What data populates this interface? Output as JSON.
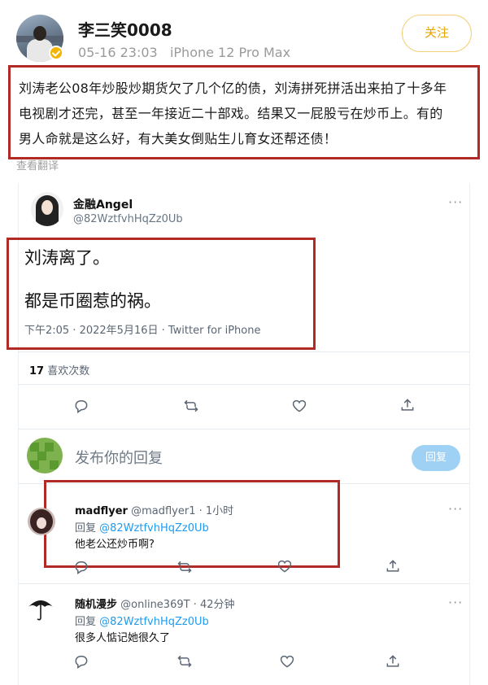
{
  "weibo": {
    "user_name": "李三笑0008",
    "post_time": "05-16 23:03",
    "device": "iPhone 12 Pro Max",
    "follow_label": "关注",
    "post_lines": [
      "刘涛老公08年炒股炒期货欠了几个亿的债，刘涛拼死拼活出来拍了十多年",
      "电视剧才还完，甚至一年接近二十部戏。结果又一屁股亏在炒币上。有的",
      "男人命就是这么好，有大美女倒贴生儿育女还帮还债！"
    ],
    "translate_label": "查看翻译"
  },
  "tweet": {
    "author_name": "金融Angel",
    "author_handle": "@82WztfvhHqZz0Ub",
    "line1": "刘涛离了。",
    "line2": "都是币圈惹的祸。",
    "timestamp": "下午2:05 · 2022年5月16日 · Twitter for iPhone",
    "likes_count": "17",
    "likes_label": "喜欢次数",
    "more_icon": "more-horizontal-icon"
  },
  "reply_box": {
    "placeholder": "发布你的回复",
    "button_label": "回复"
  },
  "replies": [
    {
      "name": "madflyer",
      "handle": "@madflyer1",
      "time": "· 1小时",
      "reply_prefix": "回复",
      "reply_to": "@82WztfvhHqZz0Ub",
      "text": "他老公还炒币啊?"
    },
    {
      "name": "随机漫步",
      "handle": "@online369T",
      "time": "· 42分钟",
      "reply_prefix": "回复",
      "reply_to": "@82WztfvhHqZz0Ub",
      "text": "很多人惦记她很久了"
    }
  ],
  "colors": {
    "highlight_border": "#b12a25",
    "follow_accent": "#e8a400",
    "twitter_blue": "#1d9bf0",
    "reply_button": "#9fd1f4"
  },
  "icons": [
    "reply-icon",
    "retweet-icon",
    "like-icon",
    "share-icon",
    "more-horizontal-icon",
    "verified-badge-icon"
  ]
}
